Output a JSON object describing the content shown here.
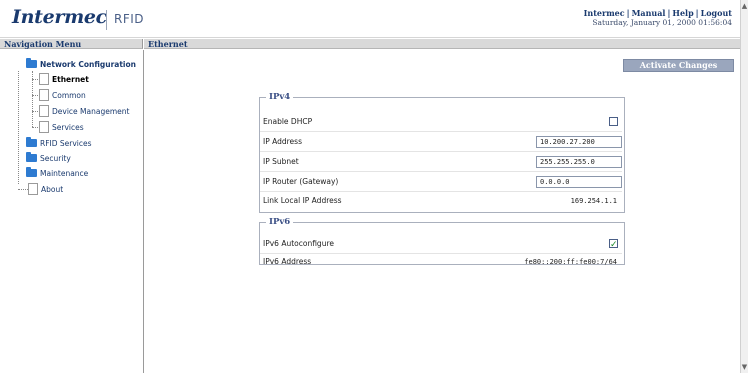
{
  "header": {
    "logo_text": "Intermec",
    "logo_suffix": "RFID",
    "links": [
      "Intermec",
      "Manual",
      "Help",
      "Logout"
    ],
    "link_separator": "|",
    "datetime": "Saturday, January 01, 2000 01:56:04"
  },
  "nav": {
    "title": "Navigation Menu",
    "items": [
      {
        "label": "Network Configuration",
        "icon": "folder-icon"
      },
      {
        "label": "Ethernet",
        "icon": "page-icon"
      },
      {
        "label": "Common",
        "icon": "page-icon"
      },
      {
        "label": "Device Management",
        "icon": "page-icon"
      },
      {
        "label": "Services",
        "icon": "page-icon"
      },
      {
        "label": "RFID Services",
        "icon": "folder-icon"
      },
      {
        "label": "Security",
        "icon": "folder-icon"
      },
      {
        "label": "Maintenance",
        "icon": "folder-icon"
      },
      {
        "label": "About",
        "icon": "page-icon"
      }
    ]
  },
  "main": {
    "title": "Ethernet",
    "activate_label": "Activate Changes",
    "ipv4": {
      "legend": "IPv4",
      "enable_dhcp_label": "Enable DHCP",
      "enable_dhcp_checked": false,
      "ip_address_label": "IP Address",
      "ip_address_value": "10.200.27.200",
      "ip_subnet_label": "IP Subnet",
      "ip_subnet_value": "255.255.255.0",
      "ip_router_label": "IP Router (Gateway)",
      "ip_router_value": "0.0.0.0",
      "link_local_label": "Link Local IP Address",
      "link_local_value": "169.254.1.1"
    },
    "ipv6": {
      "legend": "IPv6",
      "autoconfigure_label": "IPv6 Autoconfigure",
      "autoconfigure_checked": true,
      "address_label": "IPv6 Address",
      "address_value": "fe80::200:ff:fe00:7/64"
    }
  },
  "colors": {
    "brand": "#1a3a6e",
    "folder": "#2e7bd1",
    "button": "#9aa6bd",
    "titlebar": "#d9d9d9"
  }
}
